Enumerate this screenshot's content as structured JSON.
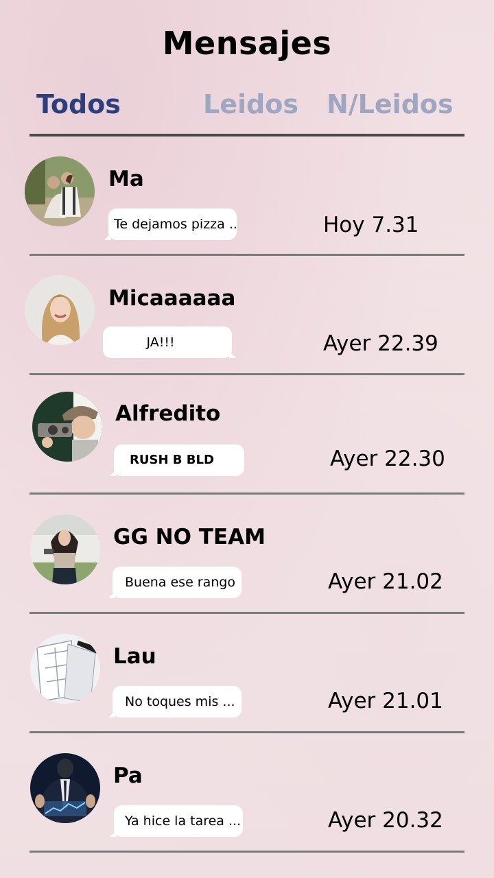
{
  "header": {
    "title": "Mensajes"
  },
  "tabs": [
    {
      "label": "Todos",
      "active": true
    },
    {
      "label": "Leidos",
      "active": false
    },
    {
      "label": "N/Leidos",
      "active": false
    }
  ],
  "colors": {
    "active_tab": "#2c3e7c",
    "inactive_tab": "#9fa6c2"
  },
  "conversations": [
    {
      "name": "Ma",
      "preview": "Te dejamos pizza ..",
      "time": "Hoy 7.31",
      "avatar": "couple-photo"
    },
    {
      "name": "Micaaaaaa",
      "preview": "JA!!!",
      "time": "Ayer 22.39",
      "avatar": "smiling-woman-photo"
    },
    {
      "name": "Alfredito",
      "preview": "RUSH B BLD",
      "time": "Ayer 22.30",
      "avatar": "camera-boy-photo"
    },
    {
      "name": "GG NO TEAM",
      "preview": "Buena ese rango",
      "time": "Ayer 21.02",
      "avatar": "woman-photo"
    },
    {
      "name": "Lau",
      "preview": "No toques mis ...",
      "time": "Ayer 21.01",
      "avatar": "blueprint-photo"
    },
    {
      "name": "Pa",
      "preview": "Ya hice la tarea ...",
      "time": "Ayer 20.32",
      "avatar": "businessman-photo"
    }
  ]
}
